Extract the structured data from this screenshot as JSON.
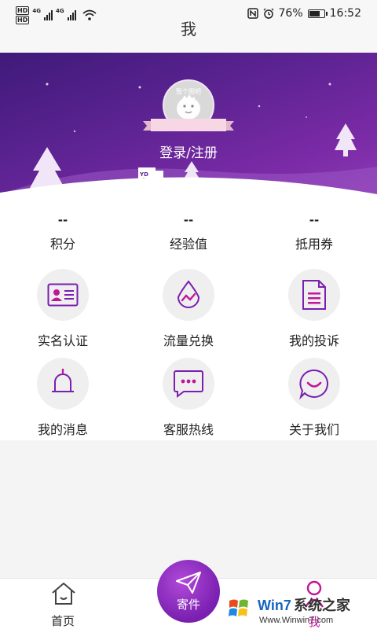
{
  "status_bar": {
    "hd1": "HD",
    "hd2": "HD",
    "net1": "4G",
    "net2": "4G",
    "battery_percent": "76%",
    "battery_level": 0.76,
    "time": "16:52"
  },
  "header": {
    "title": "我"
  },
  "profile": {
    "avatar_caption": "暂个图吧",
    "login_label": "登录/注册",
    "truck_text": "YD"
  },
  "stats": [
    {
      "value": "--",
      "label": "积分"
    },
    {
      "value": "--",
      "label": "经验值"
    },
    {
      "value": "--",
      "label": "抵用券"
    }
  ],
  "menu": [
    {
      "label": "实名认证",
      "icon": "id-card-icon"
    },
    {
      "label": "流量兑换",
      "icon": "data-drop-icon"
    },
    {
      "label": "我的投诉",
      "icon": "document-icon"
    },
    {
      "label": "我的消息",
      "icon": "bell-icon"
    },
    {
      "label": "客服热线",
      "icon": "chat-bubble-icon"
    },
    {
      "label": "关于我们",
      "icon": "smile-bubble-icon"
    }
  ],
  "bottom_nav": {
    "home_label": "首页",
    "send_label": "寄件",
    "me_label": "我"
  },
  "watermark": {
    "brand_latin": "Win7",
    "brand_cn": "系统之家",
    "url": "Www.Winwin7.com"
  },
  "colors": {
    "accent": "#c0169a",
    "purple": "#7a1fb0",
    "banner_dark": "#3f1a7a"
  }
}
